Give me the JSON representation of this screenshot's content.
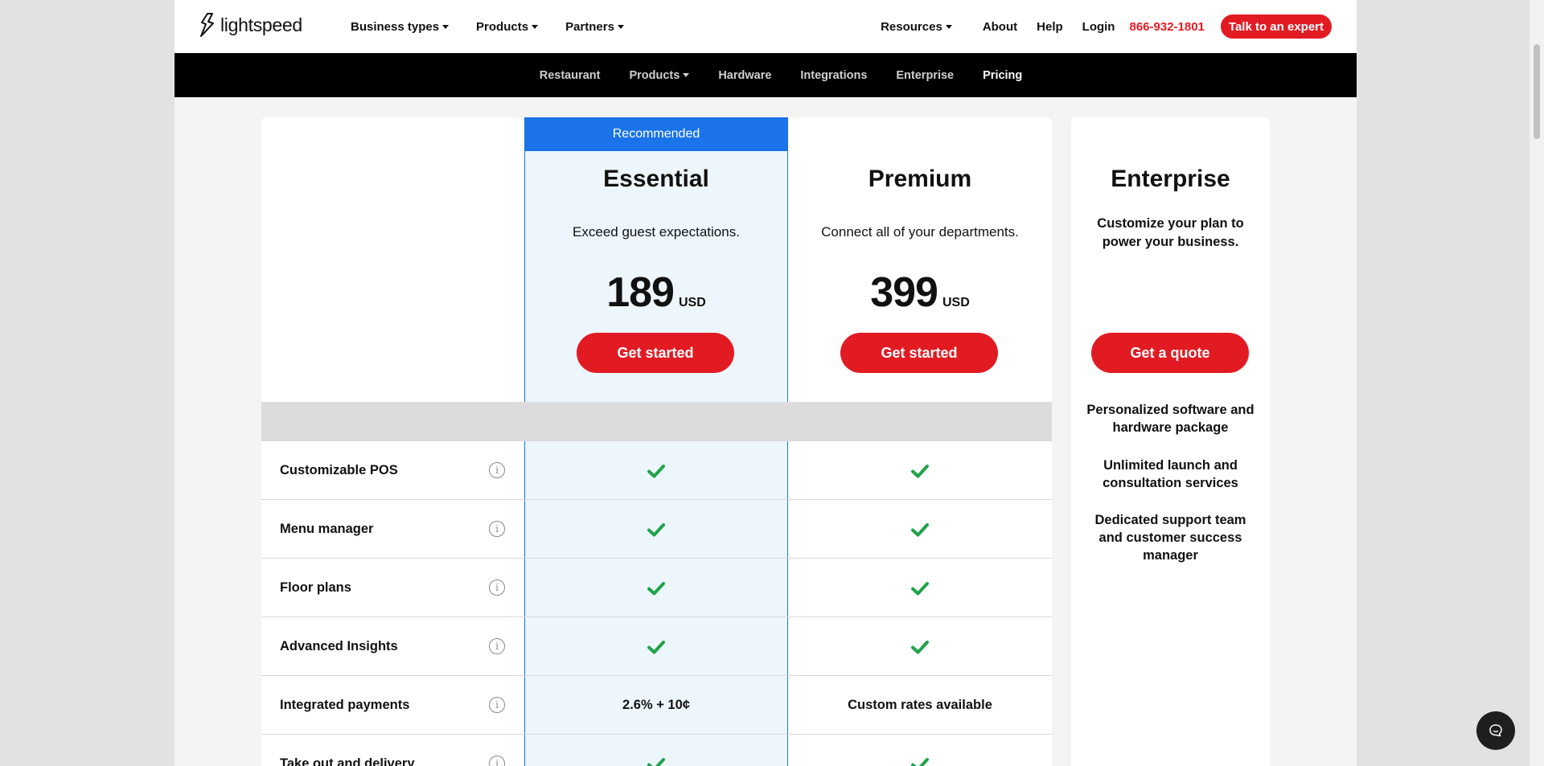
{
  "header": {
    "logo_text": "lightspeed",
    "nav_left": [
      {
        "label": "Business types",
        "has_caret": true
      },
      {
        "label": "Products",
        "has_caret": true
      },
      {
        "label": "Partners",
        "has_caret": true
      }
    ],
    "resources_label": "Resources",
    "about_label": "About",
    "help_label": "Help",
    "login_label": "Login",
    "phone": "866-932-1801",
    "cta_label": "Talk to an expert"
  },
  "subnav": {
    "items": [
      {
        "label": "Restaurant"
      },
      {
        "label": "Products",
        "has_caret": true
      },
      {
        "label": "Hardware"
      },
      {
        "label": "Integrations"
      },
      {
        "label": "Enterprise"
      },
      {
        "label": "Pricing",
        "active": true
      }
    ]
  },
  "plans": {
    "recommended_label": "Recommended",
    "essential": {
      "name": "Essential",
      "tagline": "Exceed guest expectations.",
      "price": "189",
      "currency": "USD",
      "button_label": "Get started"
    },
    "premium": {
      "name": "Premium",
      "tagline": "Connect all of your departments.",
      "price": "399",
      "currency": "USD",
      "button_label": "Get started"
    },
    "enterprise": {
      "name": "Enterprise",
      "tagline": "Customize your plan to power your business.",
      "button_label": "Get a quote",
      "features": [
        "Personalized software and hardware package",
        "Unlimited launch and consultation services",
        "Dedicated support team and customer success manager"
      ]
    }
  },
  "features": [
    {
      "label": "Customizable POS",
      "essential": "check",
      "premium": "check"
    },
    {
      "label": "Menu manager",
      "essential": "check",
      "premium": "check"
    },
    {
      "label": "Floor plans",
      "essential": "check",
      "premium": "check"
    },
    {
      "label": "Advanced Insights",
      "essential": "check",
      "premium": "check"
    },
    {
      "label": "Integrated payments",
      "essential": "2.6% + 10¢",
      "premium": "Custom rates available"
    },
    {
      "label": "Take out and delivery",
      "essential": "check",
      "premium": "check"
    }
  ],
  "colors": {
    "brand_red": "#e21b23",
    "recommended_blue": "#1a73e8",
    "check_green": "#1fa34a"
  },
  "icons": {
    "info": "info-icon",
    "check": "check-icon",
    "chat": "chat-icon"
  }
}
